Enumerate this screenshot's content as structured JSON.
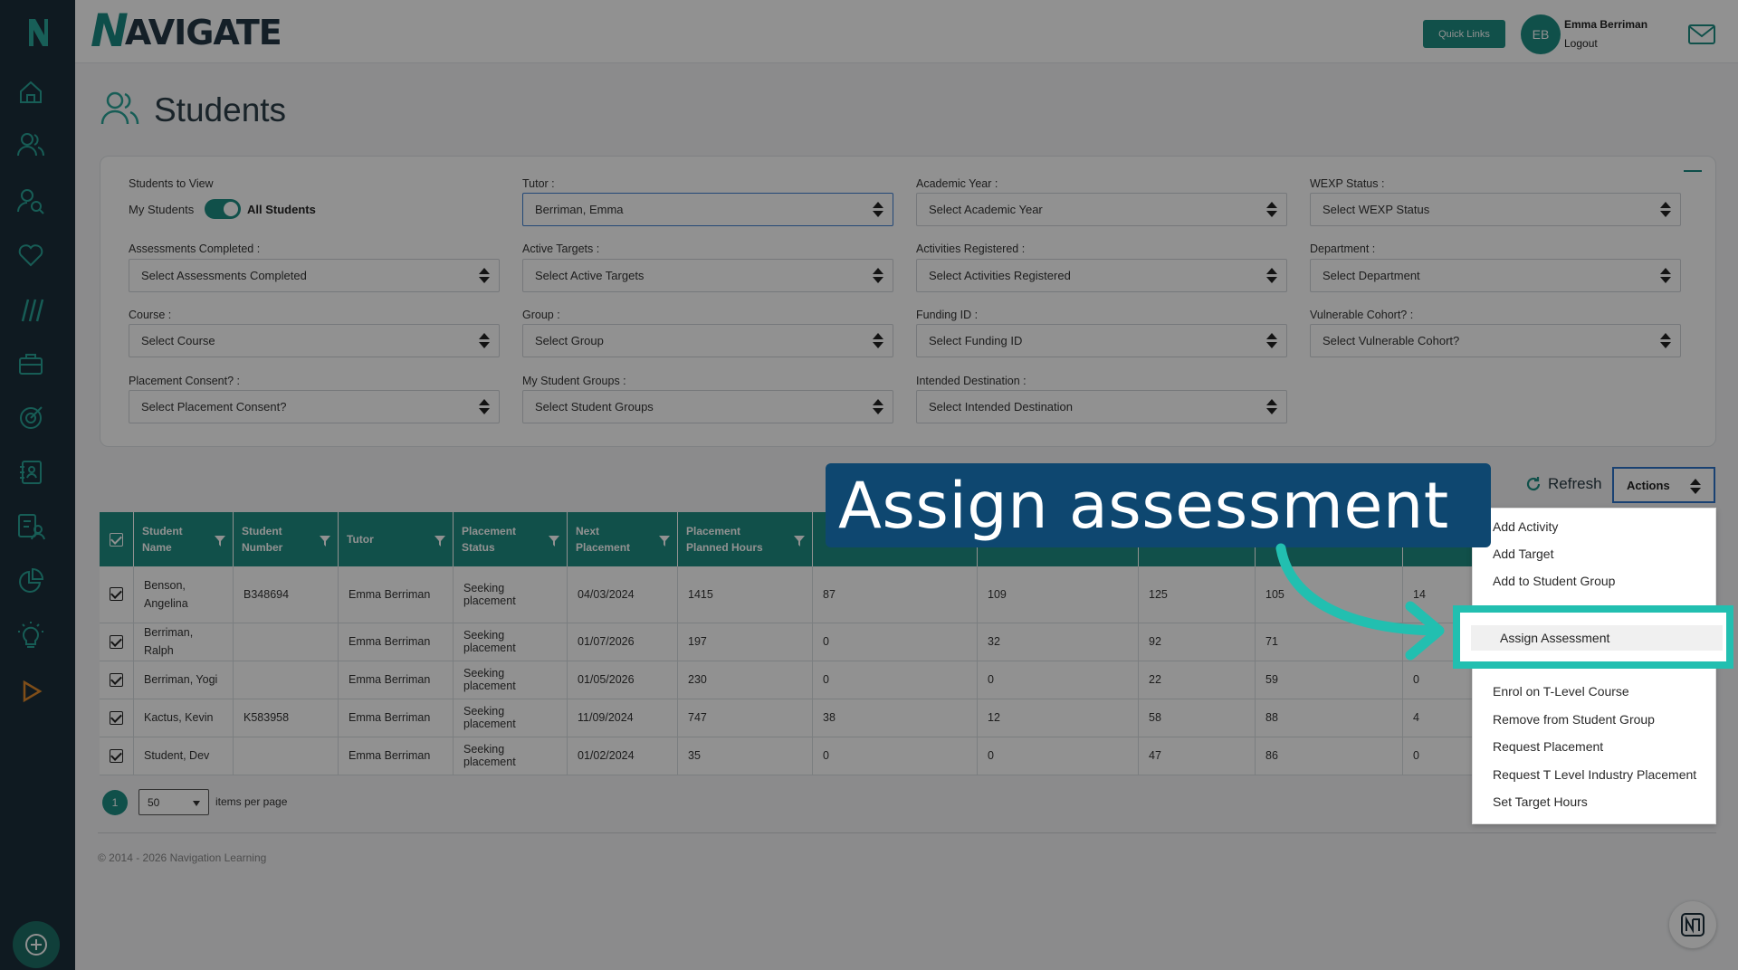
{
  "app": {
    "logo_letter": "N",
    "brand_n": "N",
    "brand_rest": "AVIGATE"
  },
  "header": {
    "quick_links": "Quick Links",
    "avatar_initials": "EB",
    "user_name": "Emma Berriman",
    "logout": "Logout"
  },
  "page": {
    "title": "Students"
  },
  "filters": {
    "students_to_view_label": "Students to View",
    "my_students": "My Students",
    "all_students": "All Students",
    "tutor_label": "Tutor :",
    "tutor_value": "Berriman, Emma",
    "academic_year_label": "Academic Year :",
    "academic_year_value": "Select Academic Year",
    "wexp_status_label": "WEXP Status :",
    "wexp_status_value": "Select WEXP Status",
    "assessments_label": "Assessments Completed :",
    "assessments_value": "Select Assessments Completed",
    "active_targets_label": "Active Targets :",
    "active_targets_value": "Select Active Targets",
    "activities_label": "Activities Registered :",
    "activities_value": "Select Activities Registered",
    "department_label": "Department :",
    "department_value": "Select Department",
    "course_label": "Course :",
    "course_value": "Select Course",
    "group_label": "Group :",
    "group_value": "Select Group",
    "funding_label": "Funding ID :",
    "funding_value": "Select Funding ID",
    "vulnerable_label": "Vulnerable Cohort? :",
    "vulnerable_value": "Select Vulnerable Cohort?",
    "placement_consent_label": "Placement Consent? :",
    "placement_consent_value": "Select Placement Consent?",
    "student_groups_label": "My Student Groups :",
    "student_groups_value": "Select Student Groups",
    "destination_label": "Intended Destination :",
    "destination_value": "Select Intended Destination"
  },
  "toolbar": {
    "refresh": "Refresh",
    "actions": "Actions"
  },
  "table": {
    "headers": {
      "name": [
        "Student",
        "Name"
      ],
      "number": [
        "Student",
        "Number"
      ],
      "tutor": "Tutor",
      "status": [
        "Placement",
        "Status"
      ],
      "next": [
        "Next",
        "Placement"
      ],
      "planned": [
        "Placement",
        "Planned Hours"
      ]
    },
    "rows": [
      {
        "name": "Benson,",
        "name2": "Angelina",
        "number": "B348694",
        "tutor": "Emma Berriman",
        "status": "Seeking placement",
        "next": "04/03/2024",
        "planned": "1415",
        "c7": "87",
        "c8": "109",
        "c9": "125",
        "c10": "105",
        "c11": "14"
      },
      {
        "name": "Berriman, Ralph",
        "name2": "",
        "number": "",
        "tutor": "Emma Berriman",
        "status": "Seeking placement",
        "next": "01/07/2026",
        "planned": "197",
        "c7": "0",
        "c8": "32",
        "c9": "92",
        "c10": "71",
        "c11": ""
      },
      {
        "name": "Berriman, Yogi",
        "name2": "",
        "number": "",
        "tutor": "Emma Berriman",
        "status": "Seeking placement",
        "next": "01/05/2026",
        "planned": "230",
        "c7": "0",
        "c8": "0",
        "c9": "22",
        "c10": "59",
        "c11": "0"
      },
      {
        "name": "Kactus, Kevin",
        "name2": "",
        "number": "K583958",
        "tutor": "Emma Berriman",
        "status": "Seeking placement",
        "next": "11/09/2024",
        "planned": "747",
        "c7": "38",
        "c8": "12",
        "c9": "58",
        "c10": "88",
        "c11": "4"
      },
      {
        "name": "Student, Dev",
        "name2": "",
        "number": "",
        "tutor": "Emma Berriman",
        "status": "Seeking placement",
        "next": "01/02/2024",
        "planned": "35",
        "c7": "0",
        "c8": "0",
        "c9": "47",
        "c10": "86",
        "c11": "0"
      }
    ]
  },
  "pagination": {
    "page": "1",
    "per_page": "50",
    "items_per_page": "items per page"
  },
  "footer": {
    "copyright": "© 2014 - 2026 Navigation Learning"
  },
  "actions_menu": {
    "items": [
      "Add Activity",
      "Add Target",
      "Add to Student Group",
      "Assign Assessment",
      "Enrol on T-Level Course",
      "Remove from Student Group",
      "Request Placement",
      "Request T Level Industry Placement",
      "Set Target Hours"
    ]
  },
  "callout": {
    "text": "Assign assessment"
  },
  "colors": {
    "teal": "#1f8d82",
    "sidebar": "#1b2f3b",
    "callout": "#0e4770",
    "highlight": "#22bfb0"
  }
}
